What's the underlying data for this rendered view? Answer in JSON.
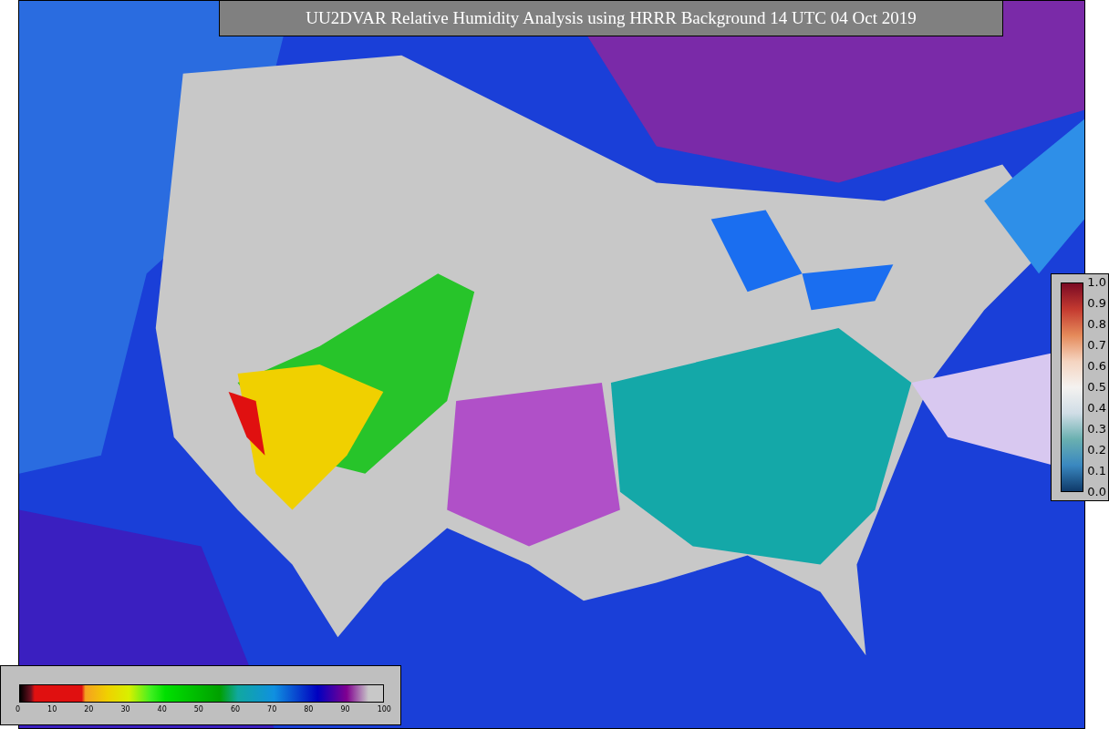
{
  "title": "UU2DVAR Relative Humidity Analysis using HRRR Background 14 UTC 04 Oct 2019",
  "observation_colorbar": {
    "ticks": [
      "1.0",
      "0.9",
      "0.8",
      "0.7",
      "0.6",
      "0.5",
      "0.4",
      "0.3",
      "0.2",
      "0.1",
      "0.0"
    ]
  },
  "humidity_colorbar": {
    "ticks": [
      "0",
      "10",
      "20",
      "30",
      "40",
      "50",
      "60",
      "70",
      "80",
      "90",
      "100"
    ]
  }
}
